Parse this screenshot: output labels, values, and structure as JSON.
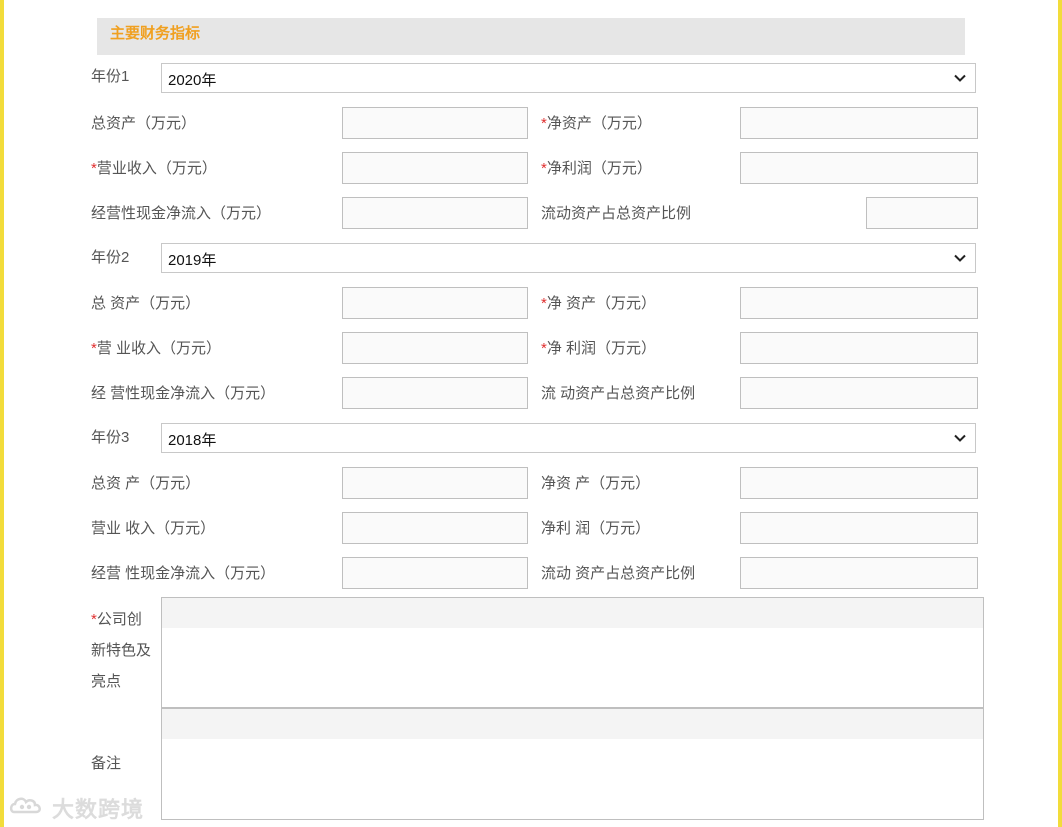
{
  "section": {
    "title": "主要财务指标"
  },
  "years": [
    {
      "label": "年份1",
      "value": "2020年",
      "fields": {
        "total_assets": {
          "req": "",
          "label": "总资产（万元）"
        },
        "net_assets": {
          "req": "*",
          "label": "净资产（万元）"
        },
        "revenue": {
          "req": "*",
          "label": "营业收入（万元）"
        },
        "net_profit": {
          "req": "*",
          "label": "净利润（万元）"
        },
        "cash_flow": {
          "req": "",
          "label": "经营性现金净流入（万元）"
        },
        "current_ratio": {
          "req": "",
          "label": "流动资产占总资产比例"
        }
      }
    },
    {
      "label": "年份2",
      "value": "2019年",
      "fields": {
        "total_assets": {
          "req": "",
          "label": "总 资产（万元）"
        },
        "net_assets": {
          "req": "*",
          "label": "净 资产（万元）"
        },
        "revenue": {
          "req": "*",
          "label": "营 业收入（万元）"
        },
        "net_profit": {
          "req": "*",
          "label": "净 利润（万元）"
        },
        "cash_flow": {
          "req": "",
          "label": "经 营性现金净流入（万元）"
        },
        "current_ratio": {
          "req": "",
          "label": "流 动资产占总资产比例"
        }
      }
    },
    {
      "label": "年份3",
      "value": "2018年",
      "fields": {
        "total_assets": {
          "req": "",
          "label": "总资 产（万元）"
        },
        "net_assets": {
          "req": "",
          "label": "净资 产（万元）"
        },
        "revenue": {
          "req": "",
          "label": "营业 收入（万元）"
        },
        "net_profit": {
          "req": "",
          "label": "净利 润（万元）"
        },
        "cash_flow": {
          "req": "",
          "label": "经营 性现金净流入（万元）"
        },
        "current_ratio": {
          "req": "",
          "label": "流动 资产占总资产比例"
        }
      }
    }
  ],
  "innovation": {
    "req": "*",
    "line1": "公司创",
    "line2": "新特色及",
    "line3": "亮点"
  },
  "remarks": {
    "label": "备注"
  },
  "watermark": {
    "text": "大数跨境",
    "icon": "cloud-logo-icon"
  },
  "colors": {
    "accent": "#f0a020",
    "required": "#e03030",
    "frame": "#f2dc3a",
    "header_bg": "#e6e6e6"
  }
}
